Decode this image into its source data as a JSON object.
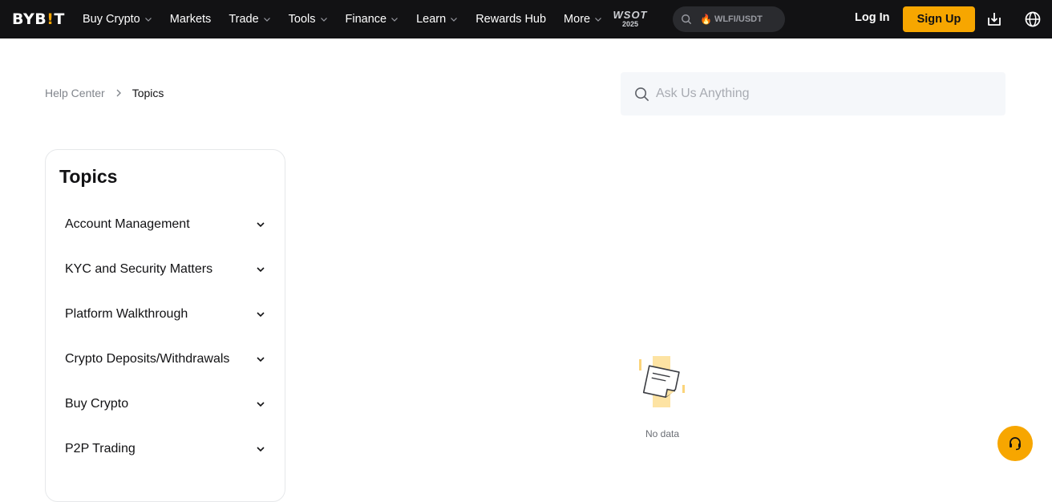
{
  "header": {
    "logo": {
      "pre": "BYB",
      "bang": "!",
      "post": "T"
    },
    "nav": [
      {
        "label": "Buy Crypto",
        "dropdown": true
      },
      {
        "label": "Markets",
        "dropdown": false
      },
      {
        "label": "Trade",
        "dropdown": true
      },
      {
        "label": "Tools",
        "dropdown": true
      },
      {
        "label": "Finance",
        "dropdown": true
      },
      {
        "label": "Learn",
        "dropdown": true
      },
      {
        "label": "Rewards Hub",
        "dropdown": false
      },
      {
        "label": "More",
        "dropdown": true
      }
    ],
    "event_badge": {
      "line1": "WSOT",
      "line2": "2025"
    },
    "search_pair": "WLFI/USDT",
    "login_label": "Log In",
    "signup_label": "Sign Up"
  },
  "breadcrumb": {
    "parent": "Help Center",
    "current": "Topics"
  },
  "search": {
    "placeholder": "Ask Us Anything"
  },
  "topics": {
    "title": "Topics",
    "items": [
      {
        "label": "Account Management"
      },
      {
        "label": "KYC and Security Matters"
      },
      {
        "label": "Platform Walkthrough"
      },
      {
        "label": "Crypto Deposits/Withdrawals"
      },
      {
        "label": "Buy Crypto"
      },
      {
        "label": "P2P Trading"
      }
    ]
  },
  "empty_state": {
    "text": "No data"
  },
  "colors": {
    "accent": "#f7a600",
    "nav_bg": "#121214"
  },
  "icons": [
    "search-icon",
    "download-icon",
    "globe-icon",
    "chevron-down-icon",
    "chevron-right-icon",
    "headset-icon",
    "fire-icon"
  ]
}
